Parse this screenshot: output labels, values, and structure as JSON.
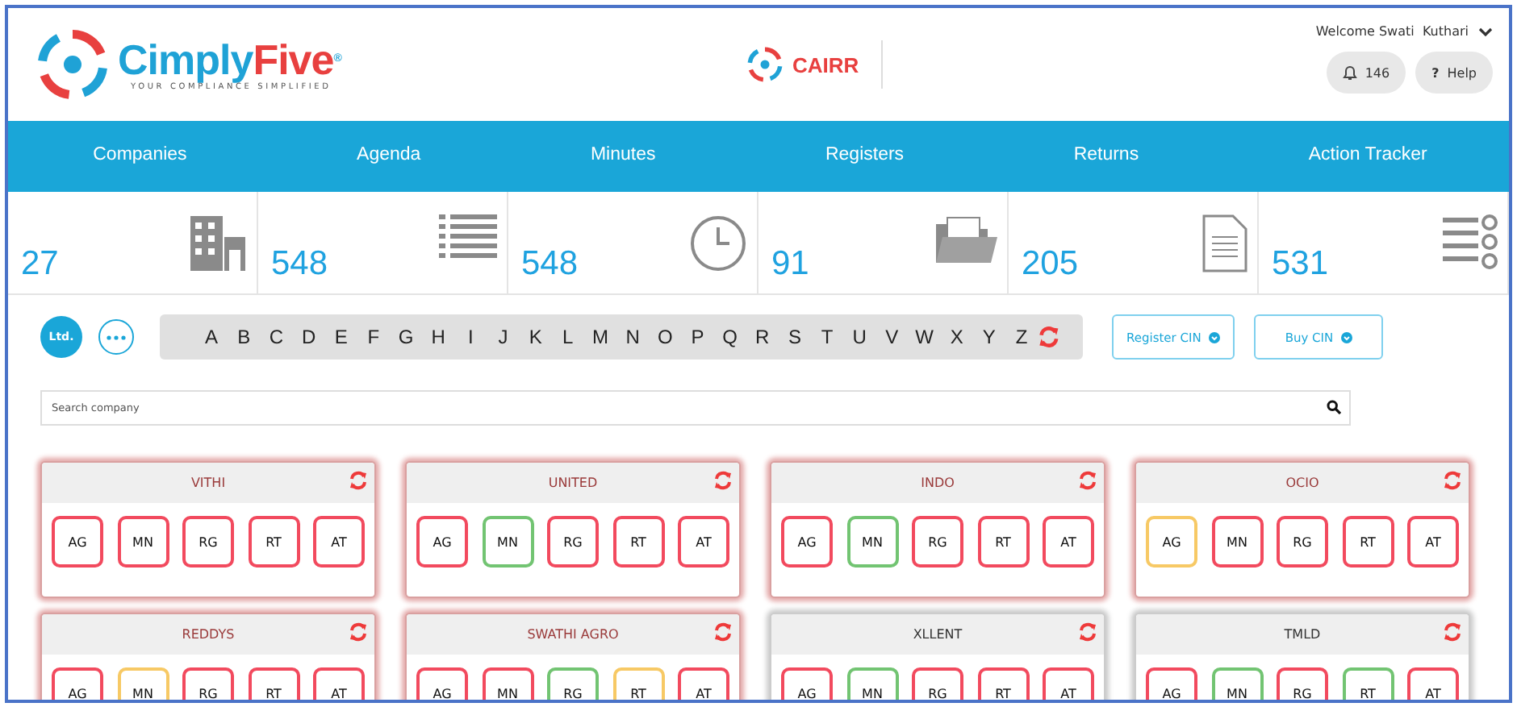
{
  "header": {
    "wordmark_parts": [
      "Cimply",
      "Five"
    ],
    "registered_mark": "®",
    "tagline": "YOUR COMPLIANCE SIMPLIFIED",
    "product": "CAIRR",
    "welcome": "Welcome Swati  Kuthari",
    "notifications": "146",
    "help_glyph": "?",
    "help": "Help"
  },
  "nav": [
    "Companies",
    "Agenda",
    "Minutes",
    "Registers",
    "Returns",
    "Action Tracker"
  ],
  "stats": [
    {
      "value": "27",
      "kind": "building"
    },
    {
      "value": "548",
      "kind": "list"
    },
    {
      "value": "548",
      "kind": "clock"
    },
    {
      "value": "91",
      "kind": "folder"
    },
    {
      "value": "205",
      "kind": "document"
    },
    {
      "value": "531",
      "kind": "checklist"
    }
  ],
  "filters": {
    "ltd": "Ltd.",
    "letters": [
      "A",
      "B",
      "C",
      "D",
      "E",
      "F",
      "G",
      "H",
      "I",
      "J",
      "K",
      "L",
      "M",
      "N",
      "O",
      "P",
      "Q",
      "R",
      "S",
      "T",
      "U",
      "V",
      "W",
      "X",
      "Y",
      "Z"
    ],
    "buttons": [
      "Register CIN",
      "Buy CIN"
    ]
  },
  "search": {
    "placeholder": "Search company"
  },
  "companies": [
    {
      "name": "VITHI",
      "alert": true,
      "chips": [
        {
          "label": "AG",
          "color": "#f24a5e"
        },
        {
          "label": "MN",
          "color": "#f24a5e"
        },
        {
          "label": "RG",
          "color": "#f24a5e"
        },
        {
          "label": "RT",
          "color": "#f24a5e"
        },
        {
          "label": "AT",
          "color": "#f24a5e"
        }
      ]
    },
    {
      "name": "UNITED",
      "alert": true,
      "chips": [
        {
          "label": "AG",
          "color": "#f24a5e"
        },
        {
          "label": "MN",
          "color": "#72c472"
        },
        {
          "label": "RG",
          "color": "#f24a5e"
        },
        {
          "label": "RT",
          "color": "#f24a5e"
        },
        {
          "label": "AT",
          "color": "#f24a5e"
        }
      ]
    },
    {
      "name": "INDO",
      "alert": true,
      "chips": [
        {
          "label": "AG",
          "color": "#f24a5e"
        },
        {
          "label": "MN",
          "color": "#72c472"
        },
        {
          "label": "RG",
          "color": "#f24a5e"
        },
        {
          "label": "RT",
          "color": "#f24a5e"
        },
        {
          "label": "AT",
          "color": "#f24a5e"
        }
      ]
    },
    {
      "name": "OCIO",
      "alert": true,
      "chips": [
        {
          "label": "AG",
          "color": "#f7c965"
        },
        {
          "label": "MN",
          "color": "#f24a5e"
        },
        {
          "label": "RG",
          "color": "#f24a5e"
        },
        {
          "label": "RT",
          "color": "#f24a5e"
        },
        {
          "label": "AT",
          "color": "#f24a5e"
        }
      ]
    },
    {
      "name": "REDDYS",
      "alert": true,
      "chips": [
        {
          "label": "AG",
          "color": "#f24a5e"
        },
        {
          "label": "MN",
          "color": "#f7c965"
        },
        {
          "label": "RG",
          "color": "#f24a5e"
        },
        {
          "label": "RT",
          "color": "#f24a5e"
        },
        {
          "label": "AT",
          "color": "#f24a5e"
        }
      ]
    },
    {
      "name": "SWATHI AGRO",
      "alert": true,
      "chips": [
        {
          "label": "AG",
          "color": "#f24a5e"
        },
        {
          "label": "MN",
          "color": "#f24a5e"
        },
        {
          "label": "RG",
          "color": "#72c472"
        },
        {
          "label": "RT",
          "color": "#f7c965"
        },
        {
          "label": "AT",
          "color": "#f24a5e"
        }
      ]
    },
    {
      "name": "XLLENT",
      "alert": false,
      "chips": [
        {
          "label": "AG",
          "color": "#f24a5e"
        },
        {
          "label": "MN",
          "color": "#72c472"
        },
        {
          "label": "RG",
          "color": "#f24a5e"
        },
        {
          "label": "RT",
          "color": "#f24a5e"
        },
        {
          "label": "AT",
          "color": "#f24a5e"
        }
      ]
    },
    {
      "name": "TMLD",
      "alert": false,
      "chips": [
        {
          "label": "AG",
          "color": "#f24a5e"
        },
        {
          "label": "MN",
          "color": "#72c472"
        },
        {
          "label": "RG",
          "color": "#f24a5e"
        },
        {
          "label": "RT",
          "color": "#72c472"
        },
        {
          "label": "AT",
          "color": "#f24a5e"
        }
      ]
    }
  ]
}
